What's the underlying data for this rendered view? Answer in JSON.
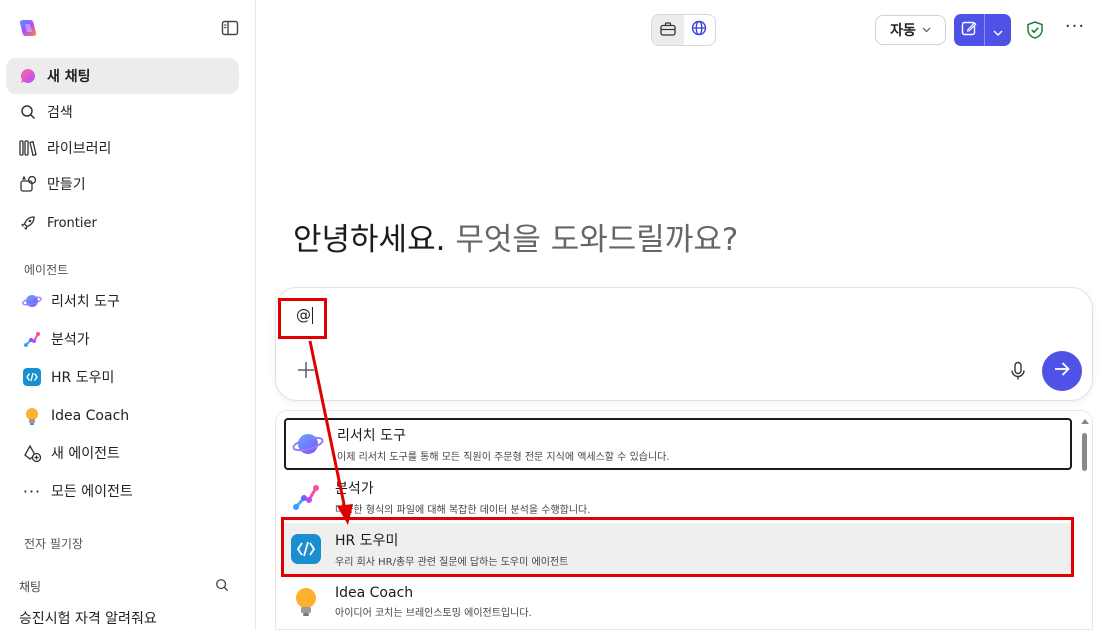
{
  "sidebar": {
    "nav": [
      {
        "label": "새 채팅",
        "icon": "copilot-chat-icon"
      },
      {
        "label": "검색",
        "icon": "search-icon"
      },
      {
        "label": "라이브러리",
        "icon": "library-icon"
      },
      {
        "label": "만들기",
        "icon": "create-icon"
      },
      {
        "label": "Frontier",
        "icon": "rocket-icon"
      }
    ],
    "agents_header": "에이전트",
    "agents": [
      {
        "label": "리서치 도구",
        "icon": "research-icon"
      },
      {
        "label": "분석가",
        "icon": "analyst-icon"
      },
      {
        "label": "HR 도우미",
        "icon": "hr-helper-icon"
      },
      {
        "label": "Idea Coach",
        "icon": "lightbulb-icon"
      },
      {
        "label": "새 에이전트",
        "icon": "new-agent-icon"
      },
      {
        "label": "모든 에이전트",
        "icon": "more-icon"
      }
    ],
    "notebook_header": "전자 필기장",
    "chats_header": "채팅",
    "chats": [
      "승진시험 자격 알려줘요"
    ]
  },
  "topbar": {
    "mode_label": "자동",
    "work_toggle_icon": "briefcase-icon",
    "web_toggle_icon": "globe-icon"
  },
  "main": {
    "greeting_main": "안녕하세요.",
    "greeting_sub": "무엇을 도와드릴까요?",
    "input_value": "@"
  },
  "mention_list": [
    {
      "title": "리서치 도구",
      "desc": "이제 리서치 도구를 통해 모든 직원이 주문형 전문 지식에 액세스할 수 있습니다.",
      "icon": "research-icon"
    },
    {
      "title": "분석가",
      "desc": "다양한 형식의 파일에 대해 복잡한 데이터 분석을 수행합니다.",
      "icon": "analyst-icon"
    },
    {
      "title": "HR 도우미",
      "desc": "우리 회사 HR/총무 관련 질문에 답하는 도우미 에이전트",
      "icon": "hr-helper-icon"
    },
    {
      "title": "Idea Coach",
      "desc": "아이디어 코치는 브레인스토밍 에이전트입니다.",
      "icon": "lightbulb-icon"
    }
  ],
  "colors": {
    "accent": "#4f52e6",
    "annotation": "#e00000"
  }
}
